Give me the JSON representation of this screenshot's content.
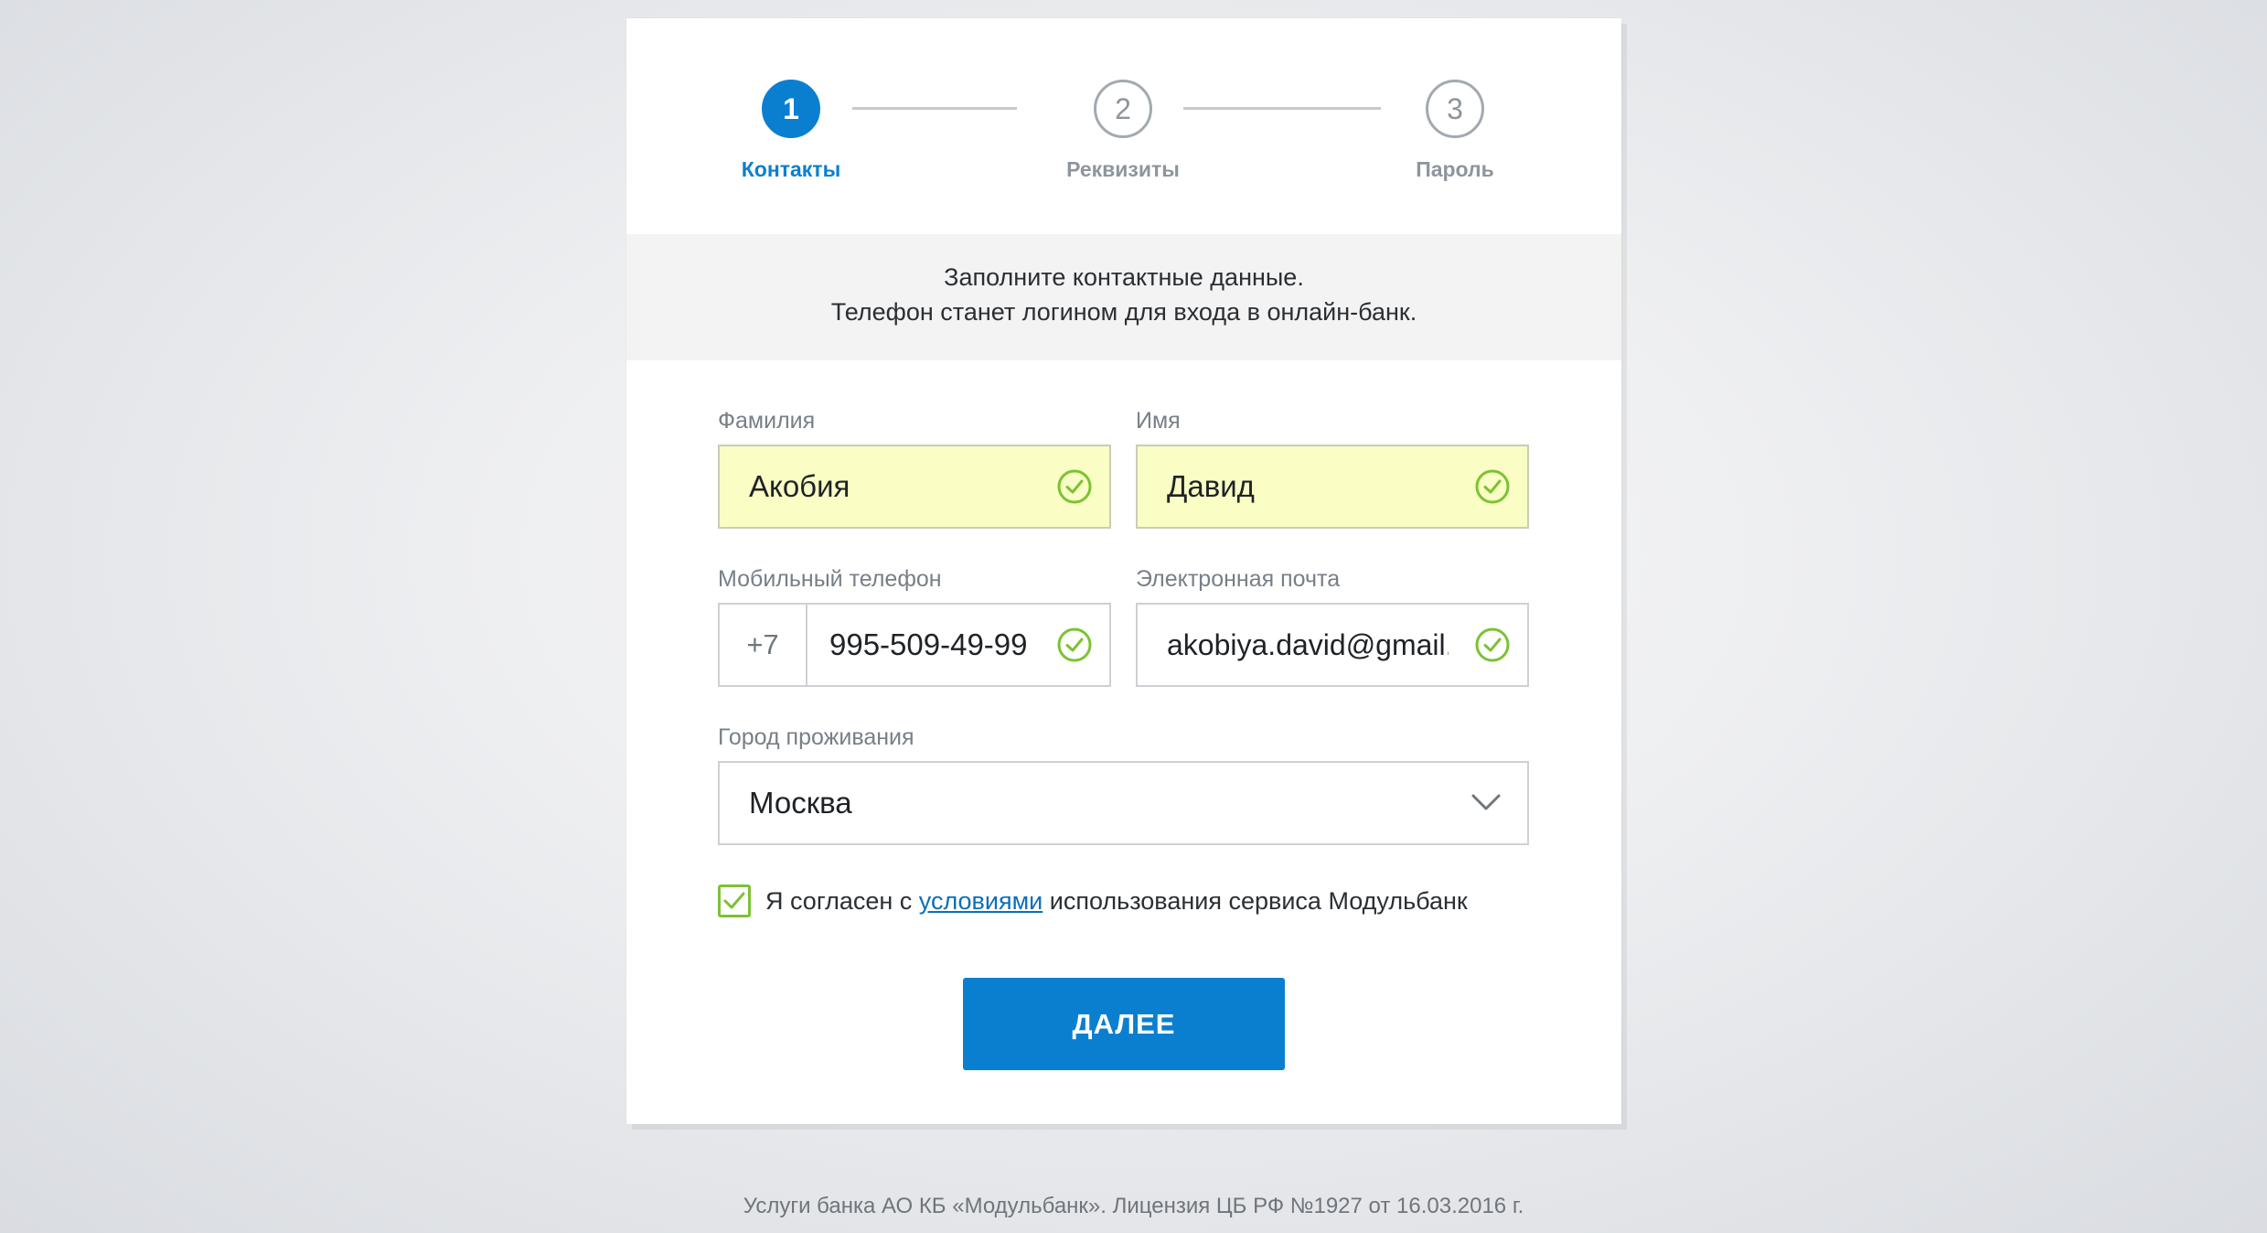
{
  "stepper": {
    "steps": [
      {
        "number": "1",
        "label": "Контакты",
        "active": true
      },
      {
        "number": "2",
        "label": "Реквизиты",
        "active": false
      },
      {
        "number": "3",
        "label": "Пароль",
        "active": false
      }
    ]
  },
  "info": {
    "line1": "Заполните контактные данные.",
    "line2": "Телефон станет логином для входа в онлайн-банк."
  },
  "form": {
    "last_name": {
      "label": "Фамилия",
      "value": "Акобия"
    },
    "first_name": {
      "label": "Имя",
      "value": "Давид"
    },
    "phone": {
      "label": "Мобильный телефон",
      "prefix": "+7",
      "value": "995-509-49-99"
    },
    "email": {
      "label": "Электронная почта",
      "value": "akobiya.david@gmail.c"
    },
    "city": {
      "label": "Город проживания",
      "value": "Москва"
    }
  },
  "agreement": {
    "checked": true,
    "text_before": "Я согласен с ",
    "link_text": "условиями",
    "text_after": " использования сервиса Модульбанк"
  },
  "next_button": {
    "label": "ДАЛЕЕ"
  },
  "footer": {
    "text": "Услуги банка АО КБ «Модульбанк». Лицензия ЦБ РФ №1927 от 16.03.2016 г."
  },
  "colors": {
    "accent": "#0a7fd0",
    "valid": "#7cc234",
    "filled_bg": "#fafdc4"
  }
}
